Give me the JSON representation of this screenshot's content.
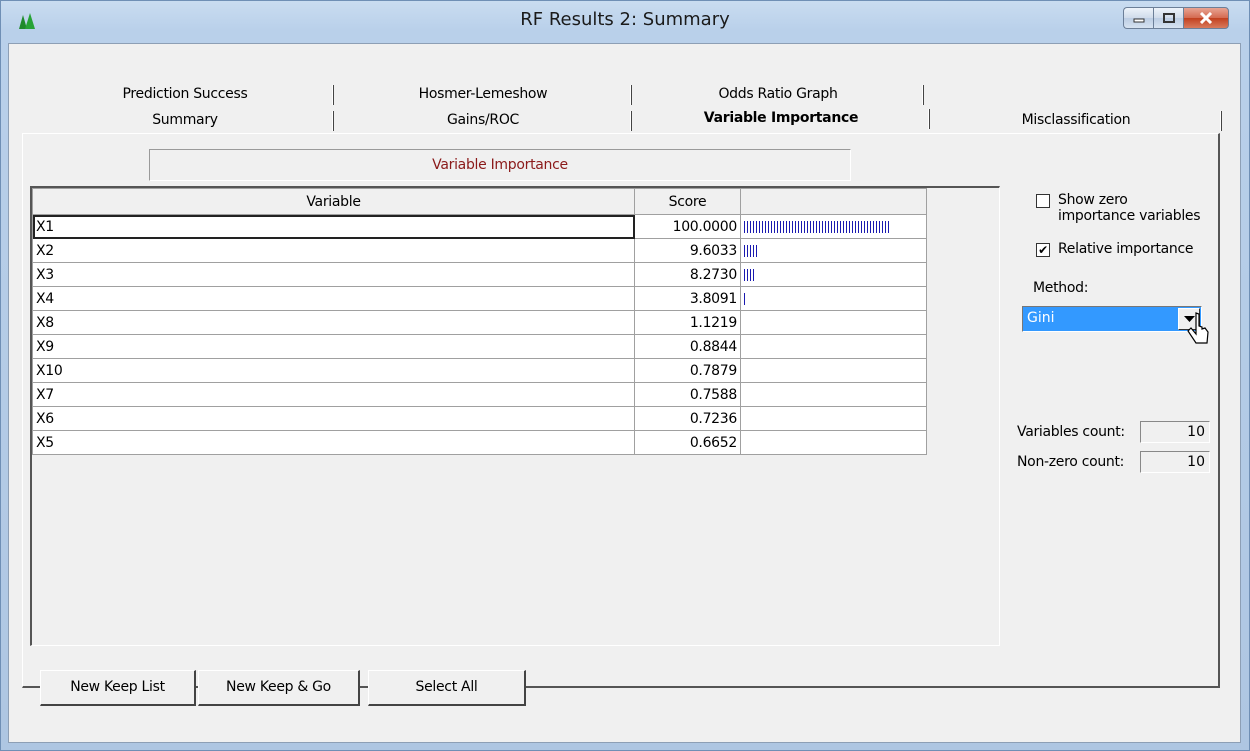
{
  "window": {
    "title": "RF Results 2: Summary"
  },
  "tabs": {
    "row1": [
      "Prediction Success",
      "Hosmer-Lemeshow",
      "Odds Ratio Graph"
    ],
    "row2": [
      "Summary",
      "Gains/ROC",
      "Variable Importance",
      "Misclassification"
    ],
    "active": "Variable Importance"
  },
  "section": {
    "title": "Variable Importance"
  },
  "grid": {
    "headers": [
      "Variable",
      "Score"
    ],
    "rows": [
      {
        "variable": "X1",
        "score": "100.0000",
        "bar_fraction": 1.0
      },
      {
        "variable": "X2",
        "score": "9.6033",
        "bar_fraction": 0.096
      },
      {
        "variable": "X3",
        "score": "8.2730",
        "bar_fraction": 0.083
      },
      {
        "variable": "X4",
        "score": "3.8091",
        "bar_fraction": 0.038
      },
      {
        "variable": "X8",
        "score": "1.1219",
        "bar_fraction": 0.0
      },
      {
        "variable": "X9",
        "score": "0.8844",
        "bar_fraction": 0.0
      },
      {
        "variable": "X10",
        "score": "0.7879",
        "bar_fraction": 0.0
      },
      {
        "variable": "X7",
        "score": "0.7588",
        "bar_fraction": 0.0
      },
      {
        "variable": "X6",
        "score": "0.7236",
        "bar_fraction": 0.0
      },
      {
        "variable": "X5",
        "score": "0.6652",
        "bar_fraction": 0.0
      }
    ],
    "bar_color": "#1a1ab0"
  },
  "options": {
    "show_zero_label_1": "Show zero",
    "show_zero_label_2": "importance variables",
    "show_zero_checked": false,
    "relative_label": "Relative importance",
    "relative_checked": true,
    "method_label": "Method:",
    "method_value": "Gini"
  },
  "counts": {
    "variables_label": "Variables count:",
    "variables_value": "10",
    "nonzero_label": "Non-zero count:",
    "nonzero_value": "10"
  },
  "buttons": {
    "new_keep_list": "New Keep List",
    "new_keep_go": "New Keep & Go",
    "select_all": "Select All"
  }
}
